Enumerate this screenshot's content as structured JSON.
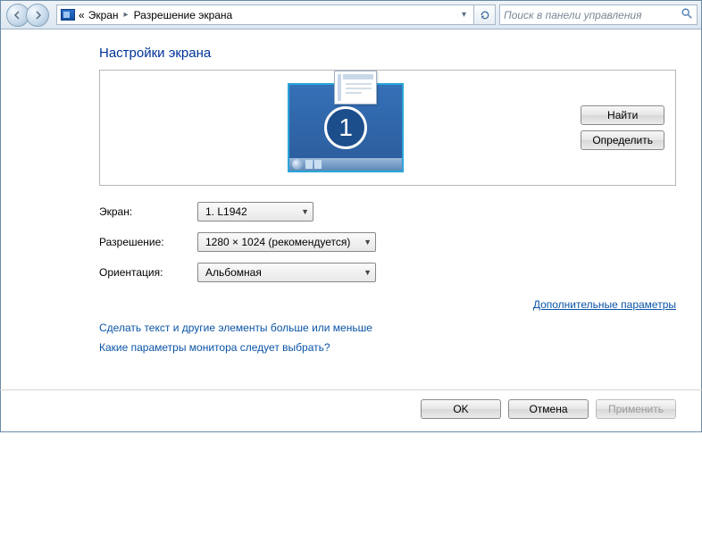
{
  "breadcrumb": {
    "prefix": "«",
    "item1": "Экран",
    "item2": "Разрешение экрана"
  },
  "search": {
    "placeholder": "Поиск в панели управления"
  },
  "page": {
    "title": "Настройки экрана",
    "find_button": "Найти",
    "identify_button": "Определить",
    "monitor_number": "1"
  },
  "form": {
    "display_label": "Экран:",
    "display_value": "1. L1942",
    "resolution_label": "Разрешение:",
    "resolution_value": "1280 × 1024 (рекомендуется)",
    "orientation_label": "Ориентация:",
    "orientation_value": "Альбомная"
  },
  "links": {
    "advanced": "Дополнительные параметры",
    "resize_text": "Сделать текст и другие элементы больше или меньше",
    "which_monitor": "Какие параметры монитора следует выбрать?"
  },
  "buttons": {
    "ok": "OK",
    "cancel": "Отмена",
    "apply": "Применить"
  }
}
